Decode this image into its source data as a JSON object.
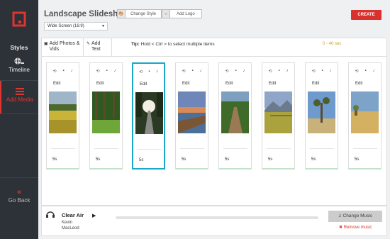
{
  "sidebar": {
    "items": [
      {
        "label": "Styles",
        "icon": "paint-palette-icon"
      },
      {
        "label": "Timeline",
        "icon": "film-reel-icon"
      },
      {
        "label": "Add Media",
        "icon": "menu-lines-icon"
      },
      {
        "label": "Go Back",
        "icon": "double-chevron-left-icon"
      }
    ],
    "accent": "#e0342f"
  },
  "header": {
    "title": "Landscape Slideshow",
    "change_style_label": "Change Style",
    "add_logo_label": "Add Logo",
    "aspect_select_value": "Wide Screen (16:9)",
    "create_label": "CREATE",
    "create_color": "#d9312d"
  },
  "toolbar": {
    "add_photos_label": "Add Photos & Vids",
    "add_text_label": "Add Text",
    "tip_prefix": "Tip:",
    "tip_text": "Hold < Ctrl > to select multiple items",
    "duration_range": "0 - 40 sec"
  },
  "slides": [
    {
      "edit_label": "Edit",
      "duration": "5s",
      "scene": "golden field"
    },
    {
      "edit_label": "Edit",
      "duration": "5s",
      "scene": "green forest"
    },
    {
      "edit_label": "Edit",
      "duration": "5s",
      "scene": "boardwalk",
      "selected": true
    },
    {
      "edit_label": "Edit",
      "duration": "5s",
      "scene": "pier sunset"
    },
    {
      "edit_label": "Edit",
      "duration": "5s",
      "scene": "dirt road"
    },
    {
      "edit_label": "Edit",
      "duration": "5s",
      "scene": "mountain meadow"
    },
    {
      "edit_label": "Edit",
      "duration": "5s",
      "scene": "joshua tree"
    },
    {
      "edit_label": "Edit",
      "duration": "5s",
      "scene": "desert plain"
    }
  ],
  "music": {
    "song_title": "Clear Air",
    "artist_line1": "Kevin",
    "artist_line2": "MacLeod",
    "change_label": "Change Music",
    "remove_label": "Remove music"
  }
}
